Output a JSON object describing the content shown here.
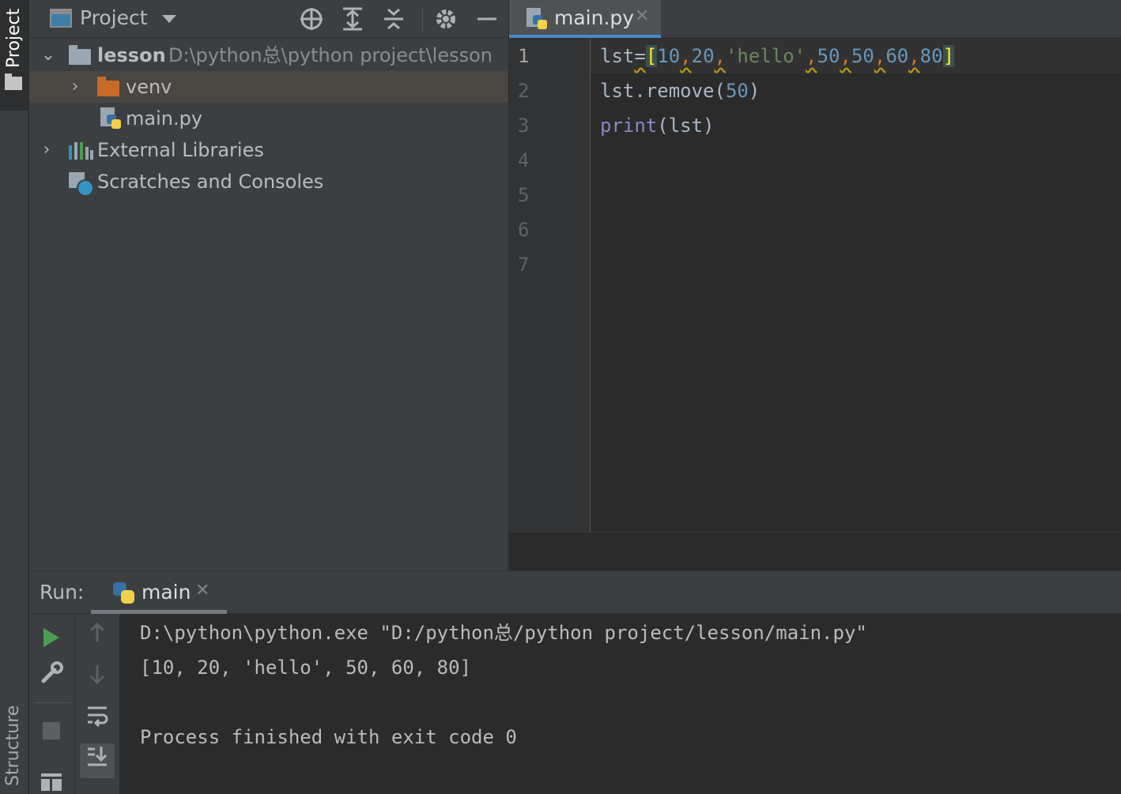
{
  "sidebar_left": {
    "project_tab": "Project",
    "structure_tab": "Structure"
  },
  "project_panel": {
    "title": "Project",
    "toolbar_icons": [
      "locate-icon",
      "expand-all-icon",
      "collapse-all-icon",
      "gear-icon",
      "minimize-icon"
    ],
    "tree": [
      {
        "label": "lesson",
        "path": "D:\\python总\\python project\\lesson",
        "expanded": true,
        "icon": "folder-icon"
      },
      {
        "label": "venv",
        "expanded": false,
        "icon": "folder-icon",
        "selected": true
      },
      {
        "label": "main.py",
        "icon": "python-file-icon"
      },
      {
        "label": "External Libraries",
        "expanded": false,
        "icon": "library-icon"
      },
      {
        "label": "Scratches and Consoles",
        "icon": "scratches-icon"
      }
    ]
  },
  "editor": {
    "tab_label": "main.py",
    "line_numbers": [
      "1",
      "2",
      "3",
      "4",
      "5",
      "6",
      "7"
    ],
    "current_line": "1",
    "code": {
      "line1": {
        "var": "lst",
        "eq": "=",
        "open": "[",
        "n1": "10",
        "c1": ",",
        "n2": "20",
        "c2": ",",
        "s1": "'hello'",
        "c3": ",",
        "n3": "50",
        "c4": ",",
        "n4": "50",
        "c5": ",",
        "n5": "60",
        "c6": ",",
        "n6": "80",
        "close": "]"
      },
      "line2": {
        "obj": "lst",
        "method": ".remove(",
        "arg": "50",
        "close": ")"
      },
      "line3": {
        "func": "print",
        "args": "(lst)"
      }
    }
  },
  "run_panel": {
    "label": "Run:",
    "tab_label": "main",
    "console": [
      "D:\\python\\python.exe \"D:/python总/python project/lesson/main.py\"",
      "[10, 20, 'hello', 50, 60, 80]",
      "",
      "Process finished with exit code 0"
    ]
  },
  "colors": {
    "accent": "#4a88c7",
    "run_green": "#499c54",
    "selection": "#4a4641"
  }
}
